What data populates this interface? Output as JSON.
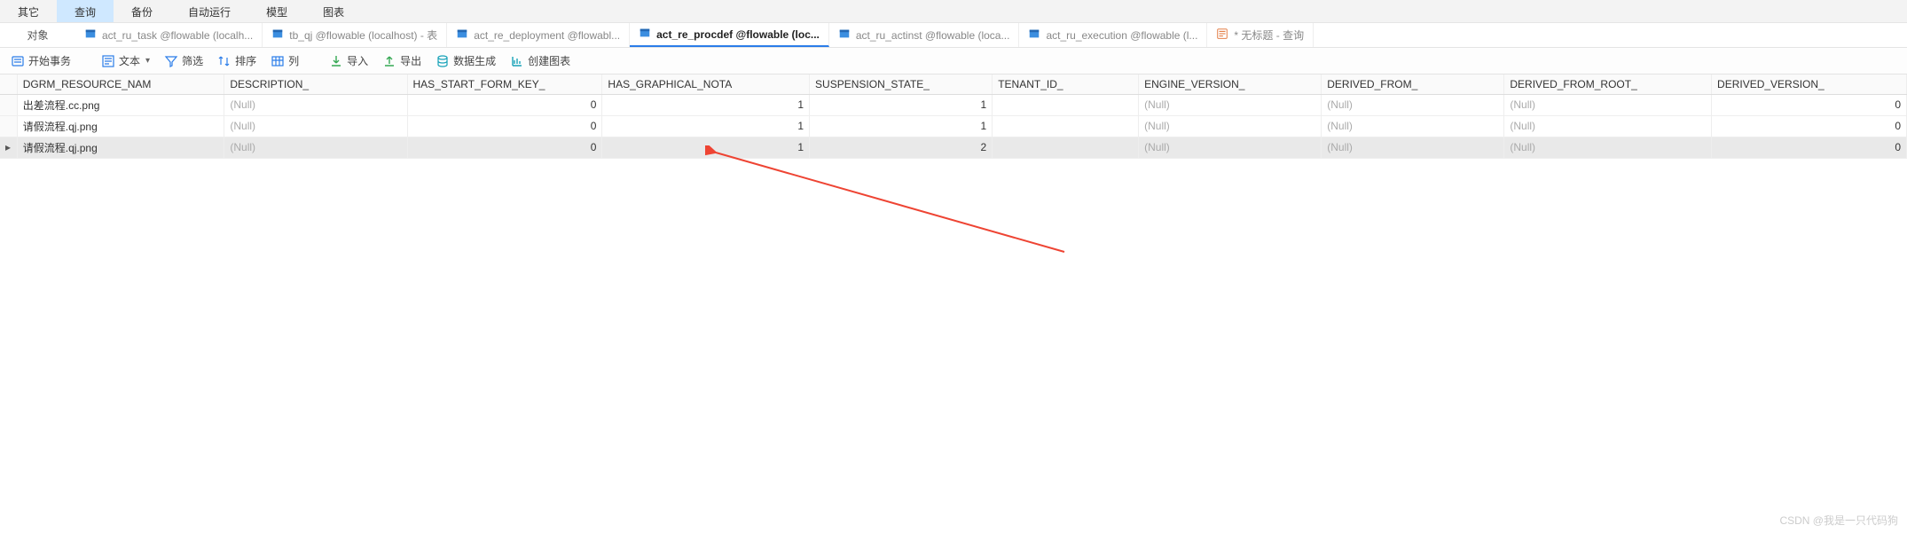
{
  "menu": {
    "items": [
      "其它",
      "查询",
      "备份",
      "自动运行",
      "模型",
      "图表"
    ],
    "activeIndex": 1
  },
  "sidepanel_label": "对象",
  "tabs": [
    {
      "label": "act_ru_task @flowable (localh...",
      "type": "table",
      "active": false
    },
    {
      "label": "tb_qj @flowable (localhost) - 表",
      "type": "table",
      "active": false
    },
    {
      "label": "act_re_deployment @flowabl...",
      "type": "table",
      "active": false
    },
    {
      "label": "act_re_procdef @flowable (loc...",
      "type": "table",
      "active": true
    },
    {
      "label": "act_ru_actinst @flowable (loca...",
      "type": "table",
      "active": false
    },
    {
      "label": "act_ru_execution @flowable (l...",
      "type": "table",
      "active": false
    },
    {
      "label": "* 无标题 - 查询",
      "type": "query",
      "active": false
    }
  ],
  "toolbar": {
    "begin_tx": "开始事务",
    "text": "文本",
    "filter": "筛选",
    "sort": "排序",
    "columns": "列",
    "import": "导入",
    "export": "导出",
    "gen": "数据生成",
    "chart": "创建图表"
  },
  "columns": [
    "DGRM_RESOURCE_NAM",
    "DESCRIPTION_",
    "HAS_START_FORM_KEY_",
    "HAS_GRAPHICAL_NOTA",
    "SUSPENSION_STATE_",
    "TENANT_ID_",
    "ENGINE_VERSION_",
    "DERIVED_FROM_",
    "DERIVED_FROM_ROOT_",
    "DERIVED_VERSION_"
  ],
  "null_label": "(Null)",
  "rows": [
    {
      "selected": false,
      "cells": [
        "出差流程.cc.png",
        null,
        "0",
        "1",
        "1",
        "",
        null,
        null,
        null,
        "0"
      ]
    },
    {
      "selected": false,
      "cells": [
        "请假流程.qj.png",
        null,
        "0",
        "1",
        "1",
        "",
        null,
        null,
        null,
        "0"
      ]
    },
    {
      "selected": true,
      "cells": [
        "请假流程.qj.png",
        null,
        "0",
        "1",
        "2",
        "",
        null,
        null,
        null,
        "0"
      ]
    }
  ],
  "numeric_cols": [
    2,
    3,
    4,
    9
  ],
  "watermark": "CSDN @我是一只代码狗"
}
